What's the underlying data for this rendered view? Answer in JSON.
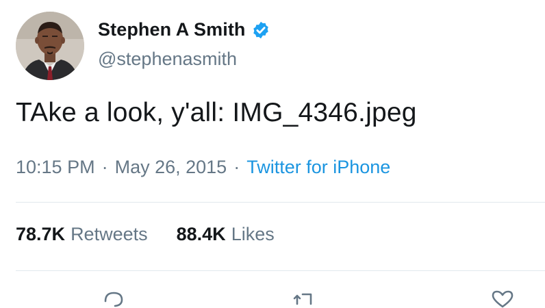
{
  "user": {
    "display_name": "Stephen A Smith",
    "handle": "@stephenasmith",
    "verified_icon": "verified-badge-icon",
    "avatar_icon": "profile-photo"
  },
  "tweet": {
    "text": "TAke a look, y'all: IMG_4346.jpeg",
    "time": "10:15 PM",
    "separator": "·",
    "date": "May 26, 2015",
    "source": "Twitter for iPhone"
  },
  "stats": {
    "retweets_count": "78.7K",
    "retweets_label": "Retweets",
    "likes_count": "88.4K",
    "likes_label": "Likes"
  },
  "actions": {
    "icons": [
      "reply-icon",
      "retweet-icon",
      "like-icon"
    ]
  },
  "colors": {
    "text": "#14171a",
    "secondary": "#657786",
    "link": "#1b95e0",
    "verified": "#1da1f2",
    "divider": "#e1e8ed"
  }
}
